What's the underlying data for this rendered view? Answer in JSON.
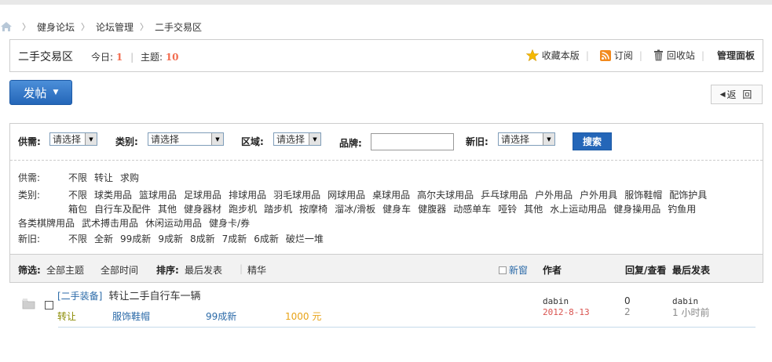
{
  "breadcrumb": [
    "健身论坛",
    "论坛管理",
    "二手交易区"
  ],
  "forum": {
    "name": "二手交易区",
    "today_label": "今日:",
    "today_value": "1",
    "topics_label": "主题:",
    "topics_value": "10"
  },
  "toolbar": {
    "favorite": "收藏本版",
    "subscribe": "订阅",
    "recycle": "回收站",
    "admin_panel": "管理面板"
  },
  "post_button": "发帖",
  "back_button": "返 回",
  "filters": {
    "supply_label": "供需:",
    "supply_value": "请选择",
    "category_label": "类别:",
    "category_value": "请选择",
    "region_label": "区域:",
    "region_value": "请选择",
    "brand_label": "品牌:",
    "condition_label": "新旧:",
    "condition_value": "请选择",
    "search_button": "搜索"
  },
  "chips": {
    "supply_label": "供需:",
    "supply": [
      "不限",
      "转让",
      "求购"
    ],
    "category_label": "类别:",
    "category_line1": [
      "不限",
      "球类用品",
      "篮球用品",
      "足球用品",
      "排球用品",
      "羽毛球用品",
      "网球用品",
      "桌球用品",
      "高尔夫球用品",
      "乒乓球用品",
      "户外用品",
      "户外用具",
      "服饰鞋帽",
      "配饰护具"
    ],
    "category_line2": [
      "箱包",
      "自行车及配件",
      "其他",
      "健身器材",
      "跑步机",
      "踏步机",
      "按摩椅",
      "溜冰/滑板",
      "健身车",
      "健腹器",
      "动感单车",
      "哑铃",
      "其他",
      "水上运动用品",
      "健身操用品",
      "钓鱼用"
    ],
    "category_line3": [
      "各类棋牌用品",
      "武术搏击用品",
      "休闲运动用品",
      "健身卡/券"
    ],
    "condition_label": "新旧:",
    "condition": [
      "不限",
      "全新",
      "99成新",
      "9成新",
      "8成新",
      "7成新",
      "6成新",
      "破烂一堆"
    ]
  },
  "sortbar": {
    "filter_label": "筛选:",
    "all_topics": "全部主题",
    "all_time": "全部时间",
    "sort_label": "排序:",
    "last_post": "最后发表",
    "digest": "精华",
    "new_window": "新窗",
    "author": "作者",
    "replies_views": "回复/查看",
    "last_reply": "最后发表"
  },
  "threads": [
    {
      "category": "[二手装备]",
      "title": "转让二手自行车一辆",
      "type": "转让",
      "class": "服饰鞋帽",
      "condition": "99成新",
      "price": "1000 元",
      "author": "dabin",
      "date": "2012-8-13",
      "replies": "0",
      "views": "2",
      "last_author": "dabin",
      "last_time": "1 小时前"
    }
  ],
  "colors": {
    "accent_blue": "#2466b8",
    "stat_red": "#f26c4f",
    "date_red": "#d9534f",
    "type_olive": "#8a8a00",
    "price_orange": "#e8a317"
  }
}
